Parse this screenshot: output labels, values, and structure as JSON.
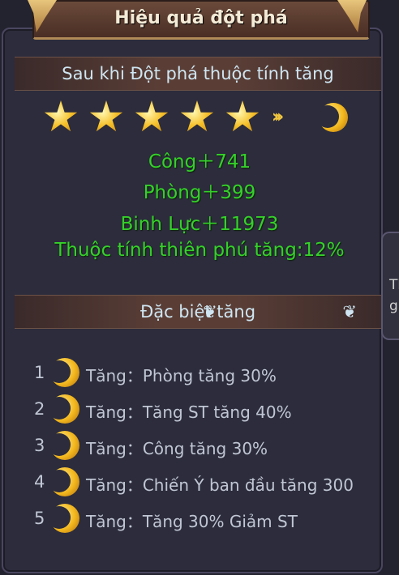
{
  "title": "Hiệu quả đột phá",
  "section1": {
    "header": "Sau khi Đột phá thuộc tính tăng"
  },
  "stars": {
    "count": 5,
    "after_icon": "moon-icon"
  },
  "stats": [
    "Công＋741",
    "Phòng＋399",
    "Binh Lực＋11973",
    "Thuộc tính thiên phú tăng:12%"
  ],
  "section2": {
    "header": "Đặc biệt tăng"
  },
  "bonuses": [
    {
      "num": "1",
      "text": "Tăng：Phòng tăng 30%"
    },
    {
      "num": "2",
      "text": "Tăng：Tăng ST tăng 40%"
    },
    {
      "num": "3",
      "text": "Tăng：Công tăng 30%"
    },
    {
      "num": "4",
      "text": "Tăng：Chiến Ý ban đầu tăng 300"
    },
    {
      "num": "5",
      "text": "Tăng：Tăng 30% Giảm ST"
    }
  ],
  "side_tab": {
    "line1": "Th",
    "line2": "gi"
  },
  "colors": {
    "stat_green": "#35d12a",
    "gold": "#f3b81f",
    "panel_bg": "#2c2c3c"
  }
}
